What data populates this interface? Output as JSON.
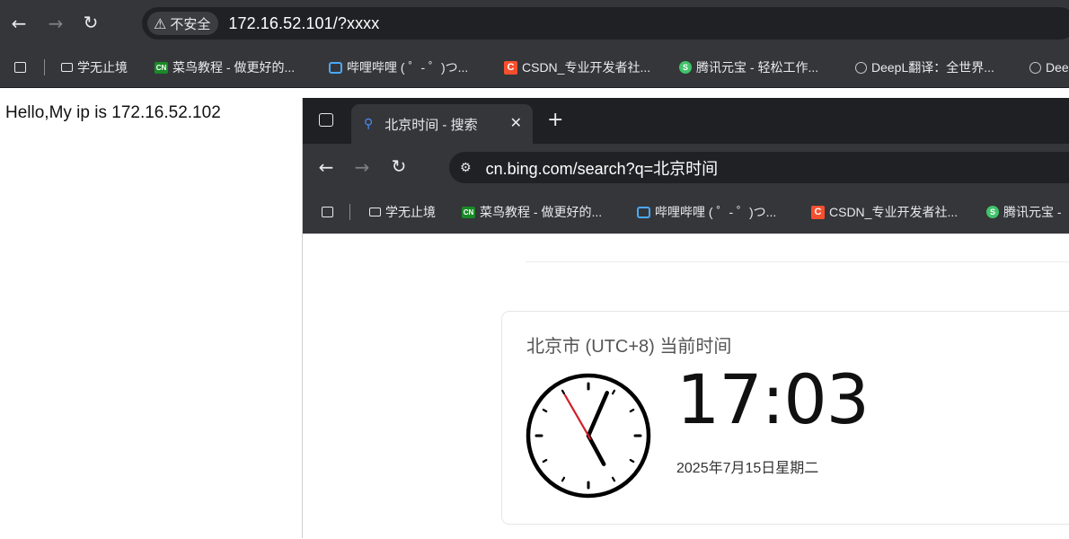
{
  "outer": {
    "address": {
      "security_label": "不安全",
      "url": "172.16.52.101/?xxxx"
    },
    "bookmarks": [
      {
        "label": "学无止境",
        "icon": "folder-icon"
      },
      {
        "label": "菜鸟教程 - 做更好的...",
        "icon": "runoob-icon"
      },
      {
        "label": "哔哩哔哩 ( ゜- ゜)つ...",
        "icon": "bilibili-icon"
      },
      {
        "label": "CSDN_专业开发者社...",
        "icon": "csdn-icon"
      },
      {
        "label": "腾讯元宝 - 轻松工作...",
        "icon": "yuanbao-icon"
      },
      {
        "label": "DeepL翻译：全世界...",
        "icon": "deepl-icon"
      },
      {
        "label": "Dee",
        "icon": "deepl-icon"
      }
    ]
  },
  "page": {
    "hello_text": "Hello,My ip is 172.16.52.102"
  },
  "inner": {
    "tab": {
      "title": "北京时间 - 搜索"
    },
    "address": {
      "url": "cn.bing.com/search?q=北京时间"
    },
    "bookmarks": [
      {
        "label": "学无止境",
        "icon": "folder-icon"
      },
      {
        "label": "菜鸟教程 - 做更好的...",
        "icon": "runoob-icon"
      },
      {
        "label": "哔哩哔哩 ( ゜- ゜)つ...",
        "icon": "bilibili-icon"
      },
      {
        "label": "CSDN_专业开发者社...",
        "icon": "csdn-icon"
      },
      {
        "label": "腾讯元宝 -",
        "icon": "yuanbao-icon"
      }
    ],
    "time_card": {
      "location_title": "北京市 (UTC+8) 当前时间",
      "time": "17:03",
      "date": "2025年7月15日星期二",
      "clock": {
        "hour": 17,
        "minute": 3,
        "second": 55
      }
    }
  },
  "colors": {
    "chrome_dark": "#35363a",
    "tab_strip": "#1f2023",
    "omnibox": "#202124",
    "search_accent": "#4c8bf5",
    "second_hand": "#d01f2b"
  }
}
